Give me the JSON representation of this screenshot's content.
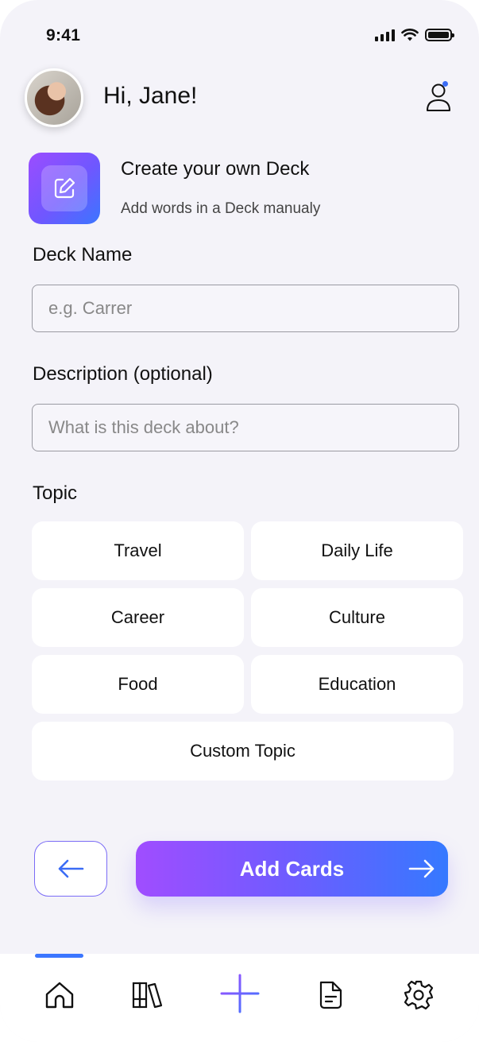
{
  "status_bar": {
    "time": "9:41"
  },
  "header": {
    "greeting": "Hi, Jane!"
  },
  "intro": {
    "title": "Create your own Deck",
    "subtitle": "Add words in a Deck manualy"
  },
  "form": {
    "deck_name_label": "Deck Name",
    "deck_name_placeholder": "e.g. Carrer",
    "description_label": "Description (optional)",
    "description_placeholder": "What is this deck about?",
    "topic_label": "Topic"
  },
  "topics": [
    "Travel",
    "Daily Life",
    "Career",
    "Culture",
    "Food",
    "Education",
    "Custom Topic"
  ],
  "actions": {
    "add_cards_label": "Add Cards"
  },
  "colors": {
    "accent_purple": "#9b4dff",
    "accent_blue": "#3b76ff",
    "background": "#f4f3f9"
  },
  "icons": {
    "profile": "user-icon",
    "deck": "edit-icon",
    "back": "arrow-left-icon",
    "next": "arrow-right-icon",
    "tabs": [
      "home-icon",
      "library-icon",
      "plus-icon",
      "document-icon",
      "gear-icon"
    ]
  }
}
